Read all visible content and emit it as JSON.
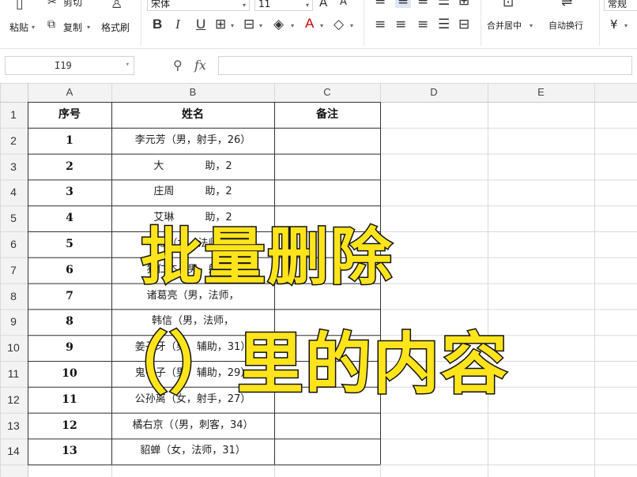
{
  "ribbon": {
    "paste_label": "粘贴",
    "cut_label": "剪切",
    "copy_label": "复制",
    "format_painter_label": "格式刷",
    "font_name": "宋体",
    "font_size": "11",
    "bold_label": "B",
    "italic_label": "I",
    "underline_label": "U",
    "merge_center_label": "合并居中",
    "auto_wrap_label": "自动换行",
    "number_format": "常规",
    "currency_symbol": "¥"
  },
  "formula_bar": {
    "name_box": "I19",
    "fx_label": "fx",
    "formula_value": ""
  },
  "columns": [
    "A",
    "B",
    "C",
    "D",
    "E"
  ],
  "rows": [
    "1",
    "2",
    "3",
    "4",
    "5",
    "6",
    "7",
    "8",
    "9",
    "10",
    "11",
    "12",
    "13",
    "14"
  ],
  "table": {
    "headers": {
      "a": "序号",
      "b": "姓名",
      "c": "备注"
    },
    "rows": [
      {
        "a": "1",
        "b": "李元芳（男，射手，26）"
      },
      {
        "a": "2",
        "b": "大　　　　助，2"
      },
      {
        "a": "3",
        "b": "庄周　　　助，2"
      },
      {
        "a": "4",
        "b": "艾琳　　　助，2"
      },
      {
        "a": "5",
        "b": "瑶（女，法师，"
      },
      {
        "a": "6",
        "b": "狄仁杰（男，射手，"
      },
      {
        "a": "7",
        "b": "诸葛亮（男，法师，"
      },
      {
        "a": "8",
        "b": "韩信（男，法师，"
      },
      {
        "a": "9",
        "b": "姜子牙（男，辅助，31）"
      },
      {
        "a": "10",
        "b": "鬼谷子（男，辅助，29）"
      },
      {
        "a": "11",
        "b": "公孙离（女，射手，27）"
      },
      {
        "a": "12",
        "b": "橘右京（（男，刺客，34）"
      },
      {
        "a": "13",
        "b": "貂蝉（女，法师，31）"
      }
    ]
  },
  "overlay": {
    "line1": "批量删除",
    "line2": "（）里的内容",
    "fill_color": "#ffe41c",
    "stroke_color": "#111111"
  }
}
